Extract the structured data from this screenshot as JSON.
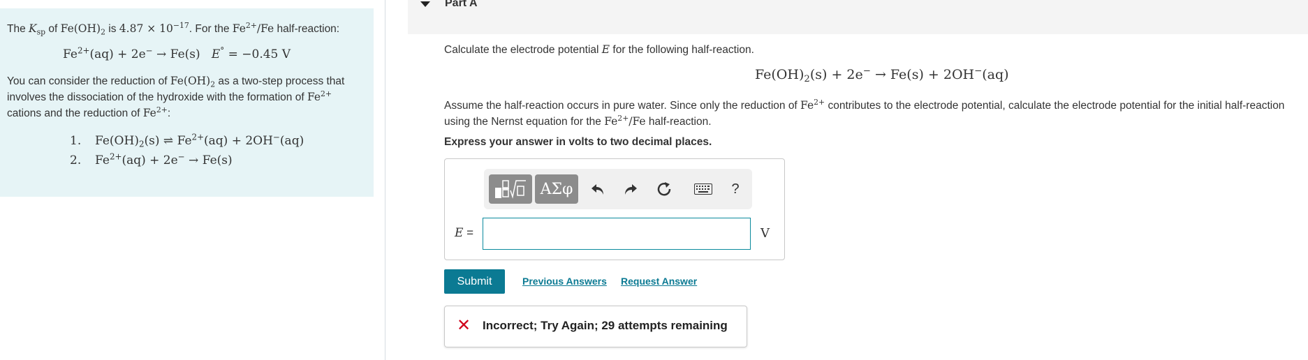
{
  "info_panel": {
    "intro_1": "The ",
    "ksp_symbol": "K",
    "ksp_sub": "sp",
    "intro_2": " of ",
    "feoh2": "Fe(OH)",
    "feoh2_sub": "2",
    "intro_3": " is ",
    "ksp_value": "4.87 × 10",
    "ksp_exp": "−17",
    "intro_4": ". For the ",
    "fe_couple": "Fe",
    "fe_couple_sup": "2+",
    "fe_couple_tail": "/Fe",
    "intro_5": " half-reaction:",
    "std_eq_left": "Fe",
    "std_eq_sup": "2+",
    "std_eq_mid": "(aq) + 2e",
    "std_eq_e_sup": "−",
    "std_eq_right": " → Fe(s)",
    "std_E": "E",
    "std_E_sup": "°",
    "std_E_val": " = −0.45 V",
    "para_1": "You can consider the reduction of ",
    "para_feoh2": "Fe(OH)",
    "para_feoh2_sub": "2",
    "para_2": " as a two-step process that involves the dissociation of the hydroxide with the formation of ",
    "para_fe": "Fe",
    "para_fe_sup": "2+",
    "para_3": " cations and the reduction of ",
    "para_fe2": "Fe",
    "para_fe2_sup": "2+",
    "para_4": ":",
    "steps": [
      {
        "num": "1.",
        "text_a": "Fe(OH)",
        "sub_a": "2",
        "text_b": "(s) ⇌ Fe",
        "sup_b": "2+",
        "text_c": "(aq) + 2OH",
        "sup_c": "−",
        "text_d": "(aq)"
      },
      {
        "num": "2.",
        "text_a": "Fe",
        "sup_a": "2+",
        "text_b": "(aq) + 2e",
        "sup_b": "−",
        "text_c": " → Fe(s)"
      }
    ]
  },
  "part": {
    "title": "Part A"
  },
  "question": {
    "line1_a": "Calculate the electrode potential ",
    "line1_E": "E",
    "line1_b": " for the following half-reaction.",
    "eq_a": "Fe(OH)",
    "eq_sub": "2",
    "eq_b": "(s) + 2e",
    "eq_sup1": "−",
    "eq_c": " → Fe(s) + 2OH",
    "eq_sup2": "−",
    "eq_d": "(aq)",
    "line2_a": "Assume the half-reaction occurs in pure water. Since only the reduction of ",
    "line2_fe": "Fe",
    "line2_fe_sup": "2+",
    "line2_b": " contributes to the electrode potential, calculate the electrode potential for the initial half-reaction using the Nernst equation for the ",
    "line2_fe2": "Fe",
    "line2_fe2_sup": "2+",
    "line2_fe2_tail": "/Fe",
    "line2_c": " half-reaction.",
    "instruction": "Express your answer in volts to two decimal places."
  },
  "toolbar": {
    "greek_label": "ΑΣφ",
    "help_label": "?"
  },
  "answer": {
    "label": "E",
    "label_eq": " =",
    "value": "",
    "unit": "V"
  },
  "actions": {
    "submit_label": "Submit",
    "previous_answers_label": "Previous Answers",
    "request_answer_label": "Request Answer"
  },
  "feedback": {
    "message": "Incorrect; Try Again; 29 attempts remaining"
  },
  "colors": {
    "info_bg": "#e6f4f6",
    "accent": "#0b7a93",
    "error": "#d0021b"
  }
}
